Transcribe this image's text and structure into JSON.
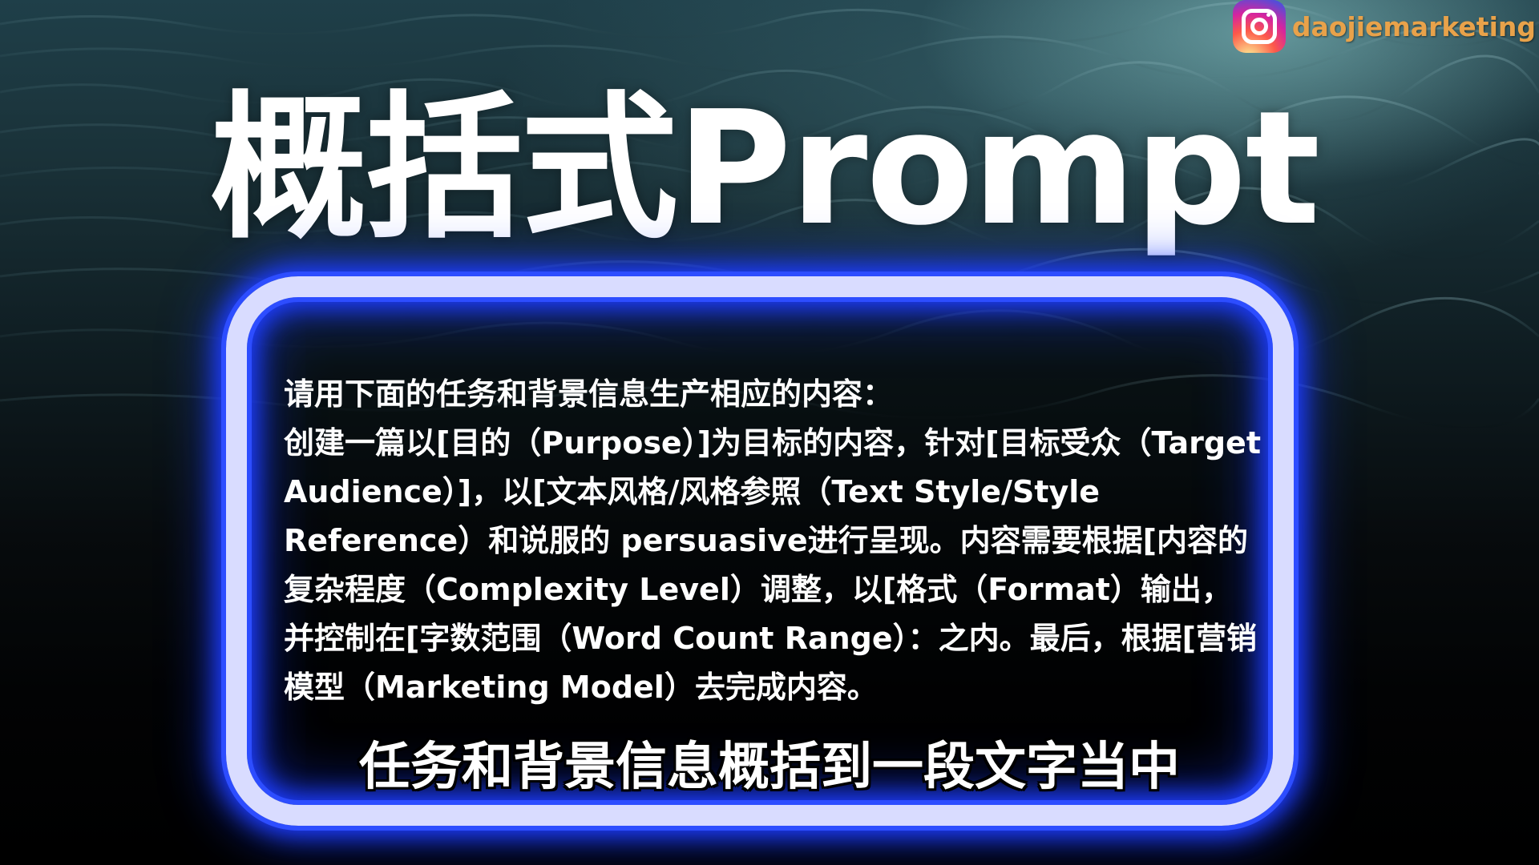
{
  "watermark": {
    "platform_icon": "instagram-icon",
    "handle": "daojiemarketing"
  },
  "headline": "概括式Prompt",
  "prompt": {
    "intro": "请用下面的任务和背景信息生产相应的内容：",
    "body": "创建一篇以[目的（Purpose）]为目标的内容，针对[目标受众（Target Audience）]，以[文本风格/风格参照（Text Style/Style Reference）和说服的 persuasive进行呈现。内容需要根据[内容的复杂程度（Complexity Level）调整，以[格式（Format）输出，并控制在[字数范围（Word Count Range）：之内。最后，根据[营销模型（Marketing Model）去完成内容。"
  },
  "subtitle": "任务和背景信息概括到一段文字当中",
  "colors": {
    "frame_glow": "#2d4dff",
    "frame_inner": "#d9dcff",
    "handle_text": "#e8a24a",
    "text": "#ffffff"
  }
}
